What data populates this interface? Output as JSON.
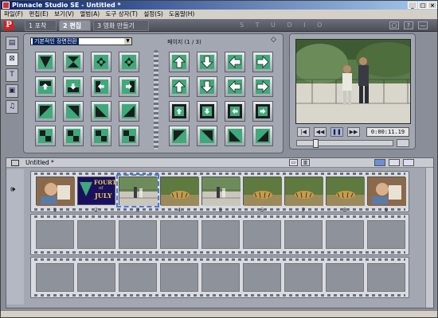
{
  "window": {
    "title": "Pinnacle Studio SE - Untitled *"
  },
  "titlebar_buttons": [
    "_",
    "□",
    "×"
  ],
  "menu": [
    "파일(F)",
    "편집(E)",
    "보기(V)",
    "앨범(A)",
    "도구 상자(T)",
    "설정(S)",
    "도움말(H)"
  ],
  "mode_tabs": [
    {
      "label": "1 포착"
    },
    {
      "label": "2 편집"
    },
    {
      "label": "3 영화 만들기"
    }
  ],
  "studio_word": "S T U D I O",
  "appbar_buttons": [
    "▢",
    "?",
    "—"
  ],
  "left_tabs": [
    {
      "icon": "video-icon",
      "glyph": "▤"
    },
    {
      "icon": "transitions-icon",
      "glyph": "⊠"
    },
    {
      "icon": "titles-icon",
      "glyph": "T"
    },
    {
      "icon": "still-image-icon",
      "glyph": "▣"
    },
    {
      "icon": "sound-icon",
      "glyph": "♫"
    }
  ],
  "album": {
    "category": "기본적인 장면전환",
    "page_label": "페이지 (1 / 3)",
    "left_tiles": [
      "wedge-down",
      "hourglass",
      "four-arrows-in",
      "four-arrows-out",
      "slide-up",
      "slide-down",
      "slide-left",
      "slide-right",
      "diag-tl",
      "diag-tr",
      "diag-bl",
      "diag-br",
      "split-v",
      "split-h",
      "split-cross",
      "split-cross2"
    ],
    "right_tiles": [
      "arrow-up",
      "arrow-down",
      "arrow-left",
      "arrow-right",
      "arrow-up2",
      "arrow-down2",
      "arrow-left2",
      "arrow-right2",
      "corner-tl",
      "corner-tr",
      "corner-bl",
      "corner-br",
      "diag-arrow-tl",
      "diag-arrow-tr",
      "diag-arrow-bl",
      "diag-arrow-br"
    ]
  },
  "player": {
    "transport": [
      "|◀",
      "◀◀",
      "❚❚",
      "▶▶"
    ],
    "timecode": "0:00:11.19",
    "scrub_position": 0.18
  },
  "movie": {
    "title": "Untitled *",
    "scenes": [
      {
        "num": "1",
        "kind": "photo"
      },
      {
        "num": "2",
        "kind": "title",
        "title_top": "FOURTH",
        "title_of": "of",
        "title_bottom": "JULY"
      },
      {
        "num": "3",
        "kind": "park",
        "selected": true
      },
      {
        "num": "4",
        "kind": "zoo"
      },
      {
        "num": "5",
        "kind": "park"
      },
      {
        "num": "6",
        "kind": "zoo"
      },
      {
        "num": "7",
        "kind": "zoo"
      },
      {
        "num": "8",
        "kind": "zoo"
      },
      {
        "num": "9",
        "kind": "photo"
      }
    ],
    "empty_rows": 2,
    "empty_per_row": 9
  },
  "colors": {
    "tile_green": "#3ea97a",
    "tile_dark": "#1c1c1c",
    "select_outline": "#4a7bd8"
  }
}
